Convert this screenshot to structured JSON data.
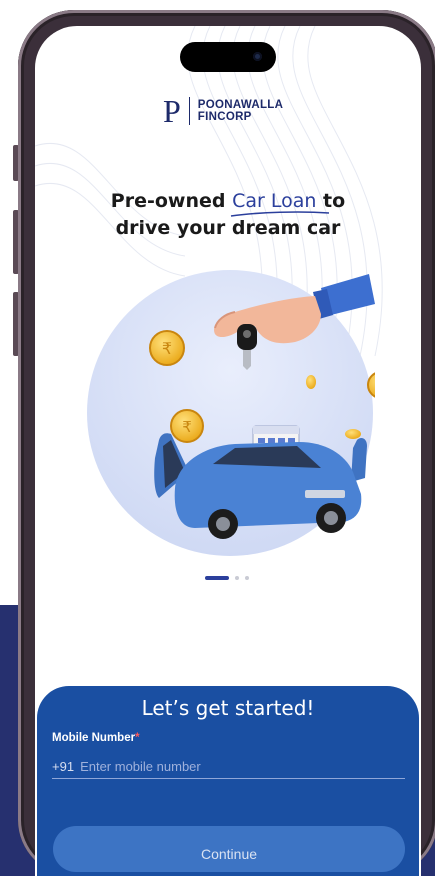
{
  "brand": {
    "mark": "P",
    "name_line1": "POONAWALLA",
    "name_line2": "FINCORP"
  },
  "headline": {
    "line1_pre": "Pre-owned ",
    "line1_accent": "Car Loan",
    "line1_post": " to",
    "line2": "drive your dream car"
  },
  "carousel": {
    "total": 3,
    "active_index": 0
  },
  "form": {
    "title": "Let’s get started!",
    "mobile_label": "Mobile Number",
    "required_mark": "*",
    "country_code": "+91",
    "mobile_placeholder": "Enter mobile number",
    "mobile_value": "",
    "continue_label": "Continue"
  },
  "colors": {
    "brand_navy": "#1d2a6a",
    "accent_blue": "#2b3f9c",
    "card_blue": "#1a4fa2",
    "button_blue": "#3d74c4",
    "background_band": "#26306f",
    "phone_frame": "#3b2f3a"
  },
  "icons": [
    "camera-icon",
    "car-key-icon",
    "rupee-coin-icon",
    "calendar-icon",
    "hand-icon",
    "car-icon"
  ]
}
